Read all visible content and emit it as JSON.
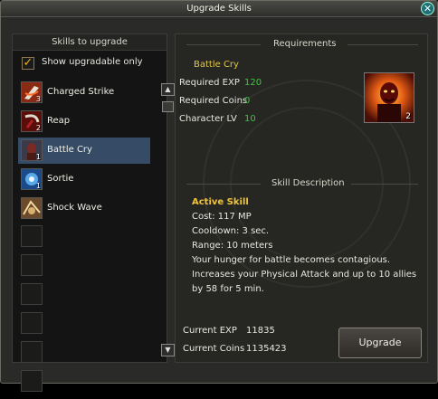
{
  "window": {
    "title": "Upgrade Skills",
    "close_glyph": "✕"
  },
  "left_panel": {
    "header": "Skills to upgrade",
    "show_upgradable_label": "Show upgradable only",
    "show_upgradable_checked": true,
    "skills": [
      {
        "name": "Charged Strike",
        "level": "3",
        "icon": "charged-strike-icon",
        "selected": false
      },
      {
        "name": "Reap",
        "level": "2",
        "icon": "reap-icon",
        "selected": false
      },
      {
        "name": "Battle Cry",
        "level": "1",
        "icon": "battle-cry-icon",
        "selected": true
      },
      {
        "name": "Sortie",
        "level": "1",
        "icon": "sortie-icon",
        "selected": false
      },
      {
        "name": "Shock Wave",
        "level": "",
        "icon": "shock-wave-icon",
        "selected": false
      }
    ],
    "empty_slots": 6
  },
  "right_panel": {
    "requirements_title": "Requirements",
    "skill_name": "Battle Cry",
    "requirements": [
      {
        "label": "Required EXP",
        "value": "120"
      },
      {
        "label": "Required Coins",
        "value": "0"
      },
      {
        "label": "Character LV",
        "value": "10"
      }
    ],
    "skill_icon_level": "2",
    "description_title": "Skill Description",
    "description": {
      "type": "Active Skill",
      "cost": "Cost: 117 MP",
      "cooldown": "Cooldown: 3 sec.",
      "range": "Range: 10 meters",
      "text": "Your hunger for battle becomes contagious. Increases your Physical Attack and up to 10 allies by 58  for 5 min."
    },
    "current": [
      {
        "label": "Current EXP",
        "value": "11835"
      },
      {
        "label": "Current Coins",
        "value": "1135423"
      }
    ],
    "upgrade_button": "Upgrade"
  },
  "colors": {
    "accent_gold": "#e2c64a",
    "value_green": "#3ec53e",
    "selected_row": "#354b66"
  }
}
